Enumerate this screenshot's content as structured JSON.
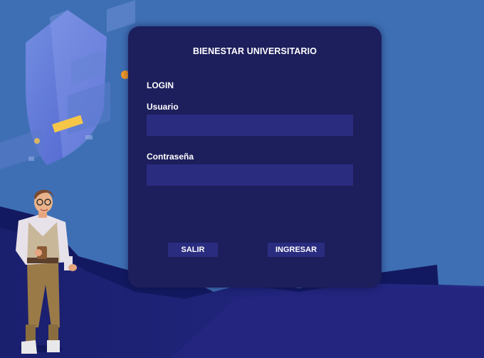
{
  "login": {
    "title": "BIENESTAR UNIVERSITARIO",
    "section_label": "LOGIN",
    "username_label": "Usuario",
    "username_value": "",
    "password_label": "Contraseña",
    "password_value": "",
    "exit_label": "SALIR",
    "submit_label": "INGRESAR"
  },
  "colors": {
    "background": "#3e6fb4",
    "card": "#1d1e5c",
    "field": "#2a2c80",
    "accent_yellow": "#f6c649",
    "accent_orange": "#f39a27"
  }
}
